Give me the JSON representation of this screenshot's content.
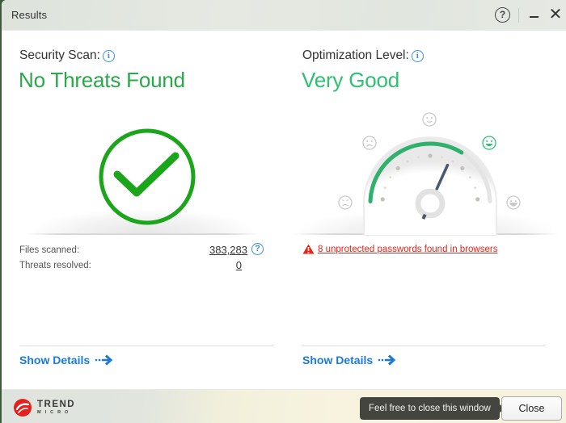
{
  "window": {
    "title": "Results",
    "help_glyph": "?",
    "close_glyph": "✕"
  },
  "security": {
    "label": "Security Scan:",
    "info_glyph": "i",
    "status": "No Threats Found",
    "status_color": "#2aa84a",
    "icon": "checkmark-circle-icon",
    "stats": [
      {
        "label": "Files scanned:",
        "value": "383,283",
        "has_help": true
      },
      {
        "label": "Threats resolved:",
        "value": "0",
        "has_help": false
      }
    ],
    "show_details": "Show Details"
  },
  "optimization": {
    "label": "Optimization Level:",
    "info_glyph": "i",
    "status": "Very Good",
    "status_color": "#2fbf73",
    "gauge": {
      "levels": [
        "angry",
        "sad",
        "neutral",
        "happy",
        "very-happy"
      ],
      "active_level": "happy",
      "fill_fraction": 0.68
    },
    "warning": "8 unprotected passwords found in browsers",
    "warning_color": "#e1261c",
    "show_details": "Show Details"
  },
  "footer": {
    "brand_top": "TREND",
    "brand_bottom": "MICRO",
    "tooltip": "Feel free to close this window",
    "close_label": "Close"
  },
  "colors": {
    "link": "#1a7ad6",
    "check_green": "#1aa51a",
    "gauge_green": "#2fb06c",
    "needle": "#4a5a6e"
  }
}
